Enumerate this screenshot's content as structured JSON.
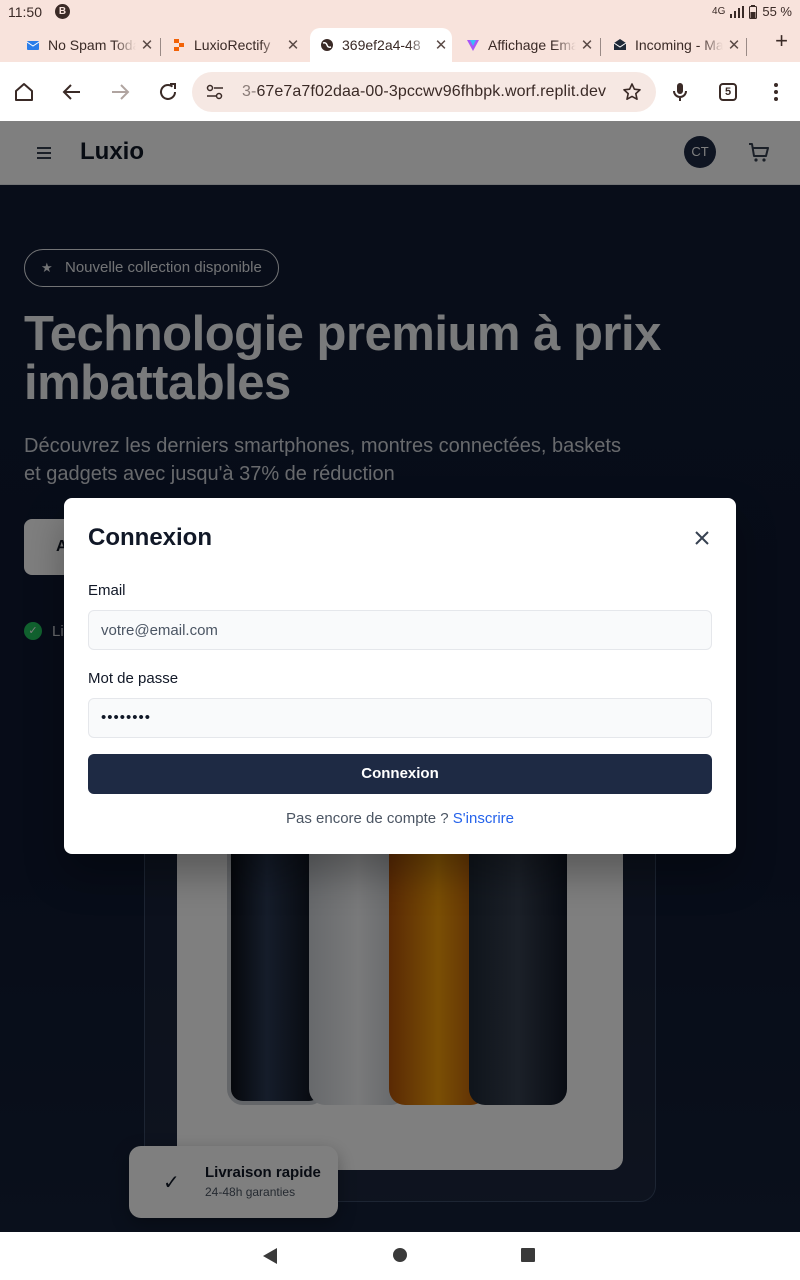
{
  "status_bar": {
    "time": "11:50",
    "notification_badge": "B",
    "network": "4G",
    "battery": "55 %"
  },
  "browser": {
    "tabs": [
      {
        "label": "No Spam Today",
        "icon": "mail-icon",
        "active": false
      },
      {
        "label": "LuxioRectify",
        "icon": "replit-icon",
        "active": false
      },
      {
        "label": "369ef2a4-48",
        "icon": "globe-icon",
        "active": true
      },
      {
        "label": "Affichage Email",
        "icon": "vuetify-icon",
        "active": false
      },
      {
        "label": "Incoming - Mail",
        "icon": "inbox-icon",
        "active": false
      }
    ],
    "url_prefix": "3-",
    "url": "67e7a7f02daa-00-3pccwv96fhbpk.worf.replit.dev",
    "tab_count": "5"
  },
  "site": {
    "brand": "Luxio",
    "avatar_initials": "CT"
  },
  "hero": {
    "badge": "Nouvelle collection disponible",
    "title": "Technologie premium à prix imbattables",
    "subtitle": "Découvrez les derniers smartphones, montres connectées, baskets et gadgets avec jusqu'à 37% de réduction",
    "cta_visible": "A",
    "feature_visible": "Li"
  },
  "delivery_card": {
    "title": "Livraison rapide",
    "subtitle": "24-48h garanties"
  },
  "modal": {
    "title": "Connexion",
    "email_label": "Email",
    "email_placeholder": "votre@email.com",
    "password_label": "Mot de passe",
    "password_value": "••••••••",
    "submit_label": "Connexion",
    "switch_text": "Pas encore de compte ?",
    "switch_link": "S'inscrire"
  },
  "colors": {
    "primary": "#1e2a44",
    "link": "#2563eb",
    "browser_chrome": "#f8e3dc"
  }
}
